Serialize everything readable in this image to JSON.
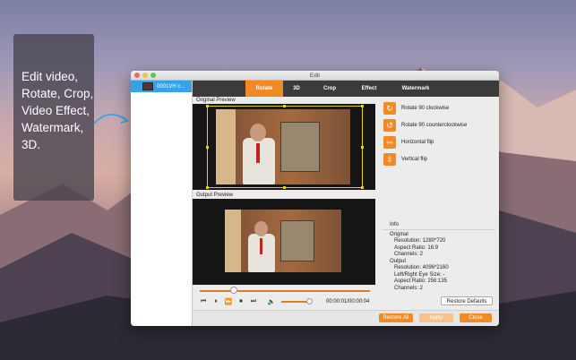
{
  "promo": {
    "lines": [
      "Edit video,",
      "Rotate, Crop,",
      "Video Effect,",
      "Watermark,",
      "3D."
    ]
  },
  "window": {
    "title": "Edit",
    "file": {
      "name": "0001VH c..."
    },
    "tabs": [
      {
        "label": "Rotate",
        "active": true
      },
      {
        "label": "3D",
        "active": false
      },
      {
        "label": "Crop",
        "active": false
      },
      {
        "label": "Effect",
        "active": false
      },
      {
        "label": "Watermark",
        "active": false
      }
    ],
    "original_preview_label": "Original Preview",
    "output_preview_label": "Output Preview",
    "player": {
      "time_current": "00:00:01",
      "time_total": "00:00:04",
      "time_text": "00:00:01/00:00:04",
      "progress": 0.2,
      "volume": 1.0
    },
    "actions": [
      {
        "label": "Rotate 90 clockwise",
        "icon": "rotate-cw-icon",
        "glyph": "↻"
      },
      {
        "label": "Rotate 90 counterclockwise",
        "icon": "rotate-ccw-icon",
        "glyph": "↺"
      },
      {
        "label": "Horizontal flip",
        "icon": "flip-horizontal-icon",
        "glyph": "⇿"
      },
      {
        "label": "Vertical flip",
        "icon": "flip-vertical-icon",
        "glyph": "⇳"
      }
    ],
    "info": {
      "title": "Info",
      "original_heading": "Original",
      "original": [
        "Resolution: 1280*720",
        "Aspect Ratio: 16:9",
        "Channels: 2"
      ],
      "output_heading": "Output",
      "output": [
        "Resolution: 4096*2160",
        "Left/Right Eye Size: -",
        "Aspect Ratio: 256:135",
        "Channels: 2"
      ]
    },
    "buttons": {
      "restore_defaults": "Restore Defaults",
      "restore_all": "Restore All",
      "apply": "Apply",
      "close": "Close"
    }
  },
  "colors": {
    "accent": "#f08a24",
    "selection": "#3aa0e8",
    "crop_border": "#e6d600"
  }
}
